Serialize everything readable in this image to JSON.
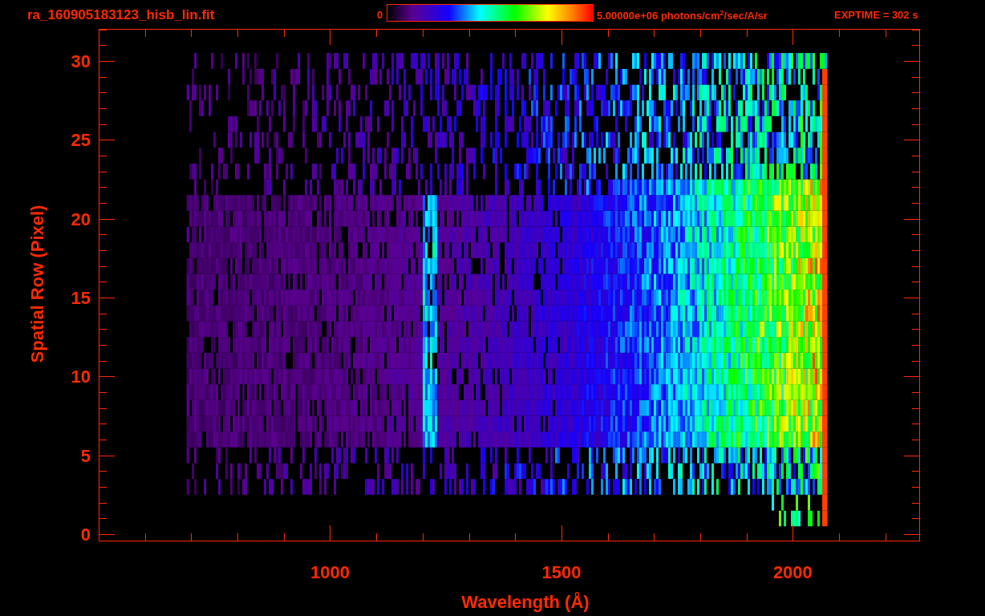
{
  "header": {
    "title": "ra_160905183123_hisb_lin.fit",
    "colorbar": {
      "min_label": "0",
      "max_label": "5.00000e+06 photons/cm$^{2}$/sec/A/sr"
    },
    "exposure": "EXPTIME = 302 s"
  },
  "plot": {
    "xlabel": "Wavelength (Å)",
    "ylabel": "Spatial Row (Pixel)",
    "xtick_labels": [
      "1000",
      "1500",
      "2000"
    ],
    "ytick_labels": [
      "30",
      "25",
      "20",
      "15",
      "10",
      "5",
      "0"
    ]
  }
}
